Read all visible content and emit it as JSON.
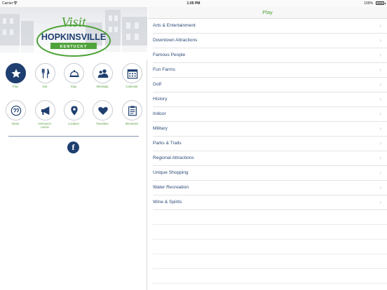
{
  "status_bar": {
    "carrier": "Carrier",
    "time": "1:05 PM",
    "battery": "100%",
    "battery_level": 1.0
  },
  "logo": {
    "line1": "Visit",
    "line2": "HOPKINSVILLE",
    "line3": "KENTUCKY"
  },
  "menu": [
    {
      "label": "Play",
      "icon": "star-icon",
      "active": true
    },
    {
      "label": "Eat",
      "icon": "fork-knife-icon",
      "active": false
    },
    {
      "label": "Stay",
      "icon": "bell-icon",
      "active": false
    },
    {
      "label": "Meetings",
      "icon": "people-icon",
      "active": false
    },
    {
      "label": "Calendar",
      "icon": "calendar-icon",
      "active": false
    },
    {
      "label": "News",
      "icon": "quote-icon",
      "active": false
    },
    {
      "label": "Announcements",
      "icon": "megaphone-icon",
      "active": false
    },
    {
      "label": "Location",
      "icon": "map-pin-icon",
      "active": false
    },
    {
      "label": "Favorites",
      "icon": "heart-icon",
      "active": false
    },
    {
      "label": "Itineraries",
      "icon": "clipboard-icon",
      "active": false
    }
  ],
  "menu_labels": {
    "announcements_line1": "Announce-",
    "announcements_line2": "ments"
  },
  "social": {
    "facebook": "f"
  },
  "nav": {
    "title": "Play"
  },
  "categories": [
    "Arts & Entertainment",
    "Downtown Attractions",
    "Famous People",
    "Fun Farms",
    "Golf",
    "History",
    "Indoor",
    "Military",
    "Parks & Trails",
    "Regional Attractions",
    "Unique Shopping",
    "Water Recreation",
    "Wine & Spirits"
  ],
  "colors": {
    "navy": "#1e3f6f",
    "green": "#4fa33a",
    "link": "#2c4a78"
  }
}
